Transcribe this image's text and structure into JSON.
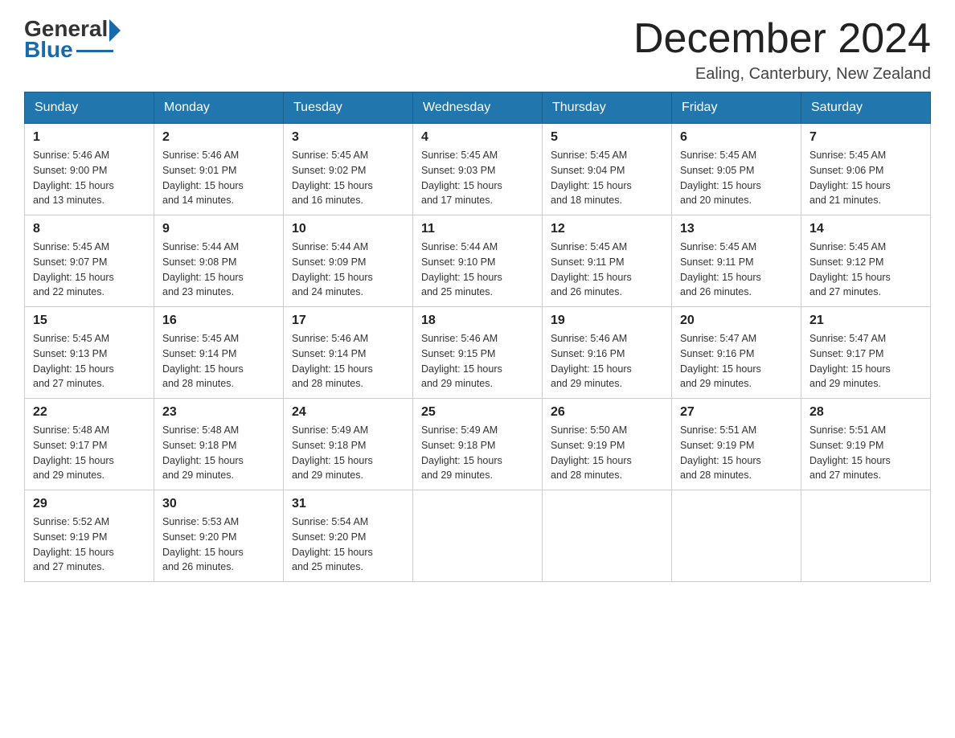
{
  "header": {
    "logo_general": "General",
    "logo_blue": "Blue",
    "month_title": "December 2024",
    "location": "Ealing, Canterbury, New Zealand"
  },
  "calendar": {
    "days_of_week": [
      "Sunday",
      "Monday",
      "Tuesday",
      "Wednesday",
      "Thursday",
      "Friday",
      "Saturday"
    ],
    "weeks": [
      [
        {
          "day": "1",
          "sunrise": "5:46 AM",
          "sunset": "9:00 PM",
          "daylight": "15 hours and 13 minutes."
        },
        {
          "day": "2",
          "sunrise": "5:46 AM",
          "sunset": "9:01 PM",
          "daylight": "15 hours and 14 minutes."
        },
        {
          "day": "3",
          "sunrise": "5:45 AM",
          "sunset": "9:02 PM",
          "daylight": "15 hours and 16 minutes."
        },
        {
          "day": "4",
          "sunrise": "5:45 AM",
          "sunset": "9:03 PM",
          "daylight": "15 hours and 17 minutes."
        },
        {
          "day": "5",
          "sunrise": "5:45 AM",
          "sunset": "9:04 PM",
          "daylight": "15 hours and 18 minutes."
        },
        {
          "day": "6",
          "sunrise": "5:45 AM",
          "sunset": "9:05 PM",
          "daylight": "15 hours and 20 minutes."
        },
        {
          "day": "7",
          "sunrise": "5:45 AM",
          "sunset": "9:06 PM",
          "daylight": "15 hours and 21 minutes."
        }
      ],
      [
        {
          "day": "8",
          "sunrise": "5:45 AM",
          "sunset": "9:07 PM",
          "daylight": "15 hours and 22 minutes."
        },
        {
          "day": "9",
          "sunrise": "5:44 AM",
          "sunset": "9:08 PM",
          "daylight": "15 hours and 23 minutes."
        },
        {
          "day": "10",
          "sunrise": "5:44 AM",
          "sunset": "9:09 PM",
          "daylight": "15 hours and 24 minutes."
        },
        {
          "day": "11",
          "sunrise": "5:44 AM",
          "sunset": "9:10 PM",
          "daylight": "15 hours and 25 minutes."
        },
        {
          "day": "12",
          "sunrise": "5:45 AM",
          "sunset": "9:11 PM",
          "daylight": "15 hours and 26 minutes."
        },
        {
          "day": "13",
          "sunrise": "5:45 AM",
          "sunset": "9:11 PM",
          "daylight": "15 hours and 26 minutes."
        },
        {
          "day": "14",
          "sunrise": "5:45 AM",
          "sunset": "9:12 PM",
          "daylight": "15 hours and 27 minutes."
        }
      ],
      [
        {
          "day": "15",
          "sunrise": "5:45 AM",
          "sunset": "9:13 PM",
          "daylight": "15 hours and 27 minutes."
        },
        {
          "day": "16",
          "sunrise": "5:45 AM",
          "sunset": "9:14 PM",
          "daylight": "15 hours and 28 minutes."
        },
        {
          "day": "17",
          "sunrise": "5:46 AM",
          "sunset": "9:14 PM",
          "daylight": "15 hours and 28 minutes."
        },
        {
          "day": "18",
          "sunrise": "5:46 AM",
          "sunset": "9:15 PM",
          "daylight": "15 hours and 29 minutes."
        },
        {
          "day": "19",
          "sunrise": "5:46 AM",
          "sunset": "9:16 PM",
          "daylight": "15 hours and 29 minutes."
        },
        {
          "day": "20",
          "sunrise": "5:47 AM",
          "sunset": "9:16 PM",
          "daylight": "15 hours and 29 minutes."
        },
        {
          "day": "21",
          "sunrise": "5:47 AM",
          "sunset": "9:17 PM",
          "daylight": "15 hours and 29 minutes."
        }
      ],
      [
        {
          "day": "22",
          "sunrise": "5:48 AM",
          "sunset": "9:17 PM",
          "daylight": "15 hours and 29 minutes."
        },
        {
          "day": "23",
          "sunrise": "5:48 AM",
          "sunset": "9:18 PM",
          "daylight": "15 hours and 29 minutes."
        },
        {
          "day": "24",
          "sunrise": "5:49 AM",
          "sunset": "9:18 PM",
          "daylight": "15 hours and 29 minutes."
        },
        {
          "day": "25",
          "sunrise": "5:49 AM",
          "sunset": "9:18 PM",
          "daylight": "15 hours and 29 minutes."
        },
        {
          "day": "26",
          "sunrise": "5:50 AM",
          "sunset": "9:19 PM",
          "daylight": "15 hours and 28 minutes."
        },
        {
          "day": "27",
          "sunrise": "5:51 AM",
          "sunset": "9:19 PM",
          "daylight": "15 hours and 28 minutes."
        },
        {
          "day": "28",
          "sunrise": "5:51 AM",
          "sunset": "9:19 PM",
          "daylight": "15 hours and 27 minutes."
        }
      ],
      [
        {
          "day": "29",
          "sunrise": "5:52 AM",
          "sunset": "9:19 PM",
          "daylight": "15 hours and 27 minutes."
        },
        {
          "day": "30",
          "sunrise": "5:53 AM",
          "sunset": "9:20 PM",
          "daylight": "15 hours and 26 minutes."
        },
        {
          "day": "31",
          "sunrise": "5:54 AM",
          "sunset": "9:20 PM",
          "daylight": "15 hours and 25 minutes."
        },
        null,
        null,
        null,
        null
      ]
    ],
    "sunrise_label": "Sunrise:",
    "sunset_label": "Sunset:",
    "daylight_label": "Daylight:"
  }
}
